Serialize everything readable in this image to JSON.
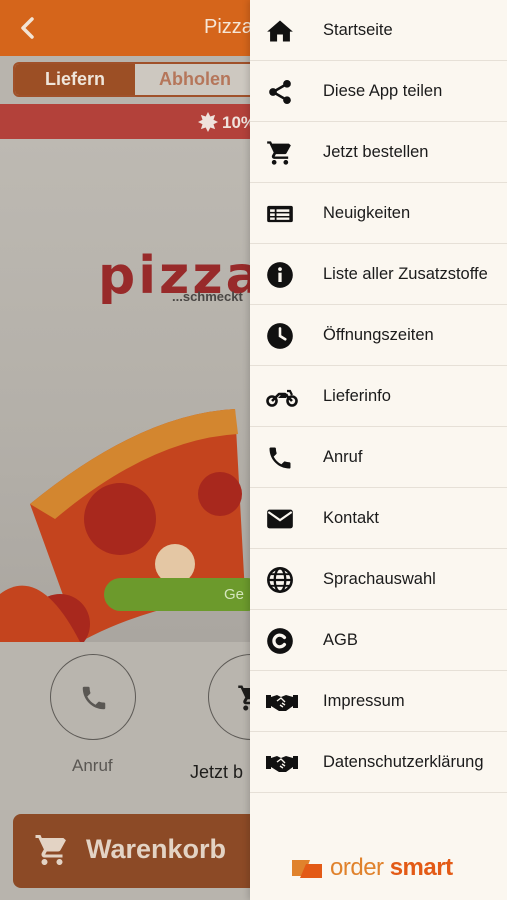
{
  "app": {
    "title": "Pizza",
    "tabs": {
      "delivery": "Liefern",
      "pickup": "Abholen"
    },
    "promo": "10%",
    "brand": {
      "name": "pizza",
      "tagline": "...schmeckt"
    },
    "status_pill": "Ge",
    "actions": {
      "call": "Anruf",
      "order": "Jetzt b"
    },
    "cart": "Warenkorb"
  },
  "colors": {
    "header": "#d5651b",
    "drawer_bg": "#fbf7f0",
    "promo": "#b3413a",
    "cart": "#8c4a26",
    "open_status": "#6c9a2c"
  },
  "menu": [
    {
      "label": "Startseite",
      "icon": "home-icon"
    },
    {
      "label": "Diese App teilen",
      "icon": "share-icon"
    },
    {
      "label": "Jetzt bestellen",
      "icon": "cart-icon"
    },
    {
      "label": "Neuigkeiten",
      "icon": "newspaper-icon"
    },
    {
      "label": "Liste aller Zusatzstoffe",
      "icon": "info-icon"
    },
    {
      "label": "Öffnungszeiten",
      "icon": "clock-icon"
    },
    {
      "label": "Lieferinfo",
      "icon": "motorcycle-icon"
    },
    {
      "label": "Anruf",
      "icon": "phone-icon"
    },
    {
      "label": "Kontakt",
      "icon": "envelope-icon"
    },
    {
      "label": "Sprachauswahl",
      "icon": "globe-icon"
    },
    {
      "label": "AGB",
      "icon": "copyright-icon"
    },
    {
      "label": "Impressum",
      "icon": "handshake-icon"
    },
    {
      "label": "Datenschutzerklärung",
      "icon": "handshake-icon"
    }
  ],
  "footer": {
    "brand_part1": "order ",
    "brand_part2": "smart"
  }
}
